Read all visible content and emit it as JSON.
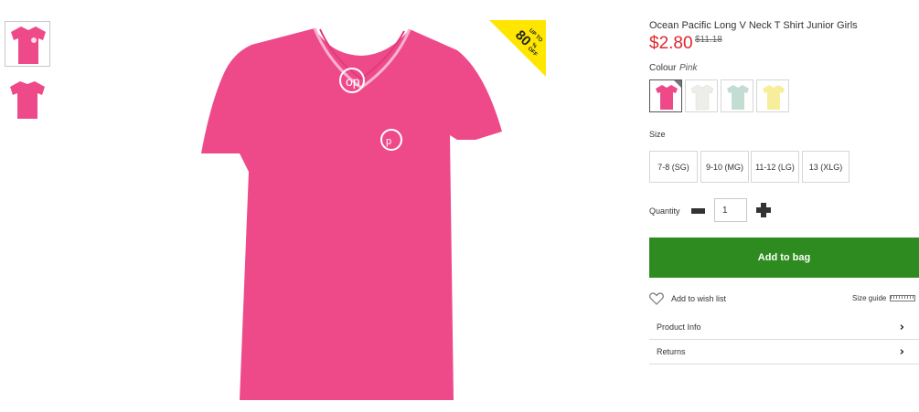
{
  "gallery": {
    "thumbnails": [
      {
        "name": "front-view",
        "selected": true
      },
      {
        "name": "back-view",
        "selected": false
      }
    ],
    "main_image_color": "#ee4a8a",
    "badge": {
      "line1": "UP TO",
      "value": "80",
      "unit": "%",
      "line2": "OFF",
      "color": "#ffe600"
    }
  },
  "product": {
    "title": "Ocean Pacific Long V Neck T Shirt Junior Girls",
    "price": "$2.80",
    "was_price": "$11.18",
    "price_color": "#e0262c"
  },
  "colour": {
    "label": "Colour",
    "selected": "Pink",
    "swatches": [
      {
        "name": "Pink",
        "hex": "#ee4a8a"
      },
      {
        "name": "White",
        "hex": "#ededea"
      },
      {
        "name": "Mint",
        "hex": "#c3ddd2"
      },
      {
        "name": "Yellow",
        "hex": "#f6ee9a"
      }
    ]
  },
  "size": {
    "label": "Size",
    "options": [
      "7-8 (SG)",
      "9-10 (MG)",
      "11-12 (LG)",
      "13 (XLG)"
    ]
  },
  "quantity": {
    "label": "Quantity",
    "value": "1"
  },
  "actions": {
    "add_to_bag": "Add to bag",
    "add_to_bag_color": "#2e8b1f",
    "wish_list": "Add to wish list",
    "size_guide": "Size guide"
  },
  "accordion": [
    {
      "label": "Product Info"
    },
    {
      "label": "Returns"
    }
  ]
}
